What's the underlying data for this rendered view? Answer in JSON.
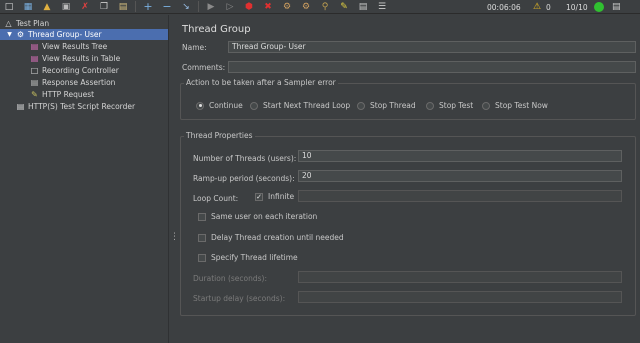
{
  "toolbar": {
    "icons": [
      "new-icon",
      "templates-icon",
      "open-icon",
      "save-icon",
      "cut-icon",
      "copy-icon",
      "paste-icon",
      "expand-icon",
      "collapse-icon",
      "toggle-icon",
      "start-icon",
      "start-no-pause-icon",
      "stop-icon",
      "shutdown-icon",
      "clear-icon",
      "clear-all-icon",
      "search-icon",
      "reset-search-icon",
      "function-helper-icon",
      "help-icon"
    ],
    "elapsed_time": "00:06:06",
    "warning_count": "0",
    "threads_active": "10/10"
  },
  "tree": {
    "items": [
      {
        "label": "Test Plan",
        "icon": "test-plan-icon"
      },
      {
        "label": "Thread Group- User",
        "icon": "thread-group-icon",
        "selected": true
      },
      {
        "label": "View Results Tree",
        "icon": "listener-icon"
      },
      {
        "label": "View Results in Table",
        "icon": "listener-icon"
      },
      {
        "label": "Recording Controller",
        "icon": "controller-icon"
      },
      {
        "label": "Response Assertion",
        "icon": "assertion-icon"
      },
      {
        "label": "HTTP Request",
        "icon": "sampler-icon"
      },
      {
        "label": "HTTP(S) Test Script Recorder",
        "icon": "recorder-icon"
      }
    ]
  },
  "main": {
    "title": "Thread Group",
    "name_label": "Name:",
    "name_value": "Thread Group- User",
    "comments_label": "Comments:",
    "comments_value": "",
    "error_action": {
      "legend": "Action to be taken after a Sampler error",
      "options": [
        "Continue",
        "Start Next Thread Loop",
        "Stop Thread",
        "Stop Test",
        "Stop Test Now"
      ],
      "selected": "Continue"
    },
    "thread_props": {
      "legend": "Thread Properties",
      "num_threads_label": "Number of Threads (users):",
      "num_threads_value": "10",
      "rampup_label": "Ramp-up period (seconds):",
      "rampup_value": "20",
      "loop_label": "Loop Count:",
      "infinite_label": "Infinite",
      "infinite_checked": true,
      "loop_value": "",
      "same_user_label": "Same user on each iteration",
      "delay_label": "Delay Thread creation until needed",
      "lifetime_label": "Specify Thread lifetime",
      "duration_label": "Duration (seconds):",
      "duration_value": "",
      "startup_label": "Startup delay (seconds):",
      "startup_value": ""
    }
  },
  "colors": {
    "selection": "#4b6eaf",
    "background": "#3c3f41",
    "field": "#45494a"
  }
}
